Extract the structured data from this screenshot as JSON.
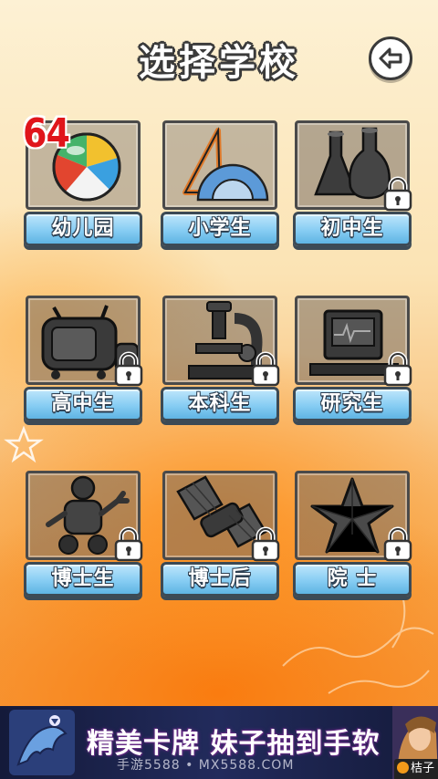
{
  "title": "选择学校",
  "score": "64",
  "schools": [
    {
      "label": "幼儿园",
      "locked": false
    },
    {
      "label": "小学生",
      "locked": false
    },
    {
      "label": "初中生",
      "locked": true
    },
    {
      "label": "高中生",
      "locked": true
    },
    {
      "label": "本科生",
      "locked": true
    },
    {
      "label": "研究生",
      "locked": true
    },
    {
      "label": "博士生",
      "locked": true
    },
    {
      "label": "博士后",
      "locked": true
    },
    {
      "label": "院 士",
      "locked": true
    }
  ],
  "ad": {
    "headline": "精美卡牌 妹子抽到手软",
    "watermark": "手游5588 • MX5588.COM",
    "brand": "桔子"
  },
  "colors": {
    "label_blue": "#87cdf3",
    "score_red": "#e0151b",
    "outline": "#3a3a3a"
  }
}
